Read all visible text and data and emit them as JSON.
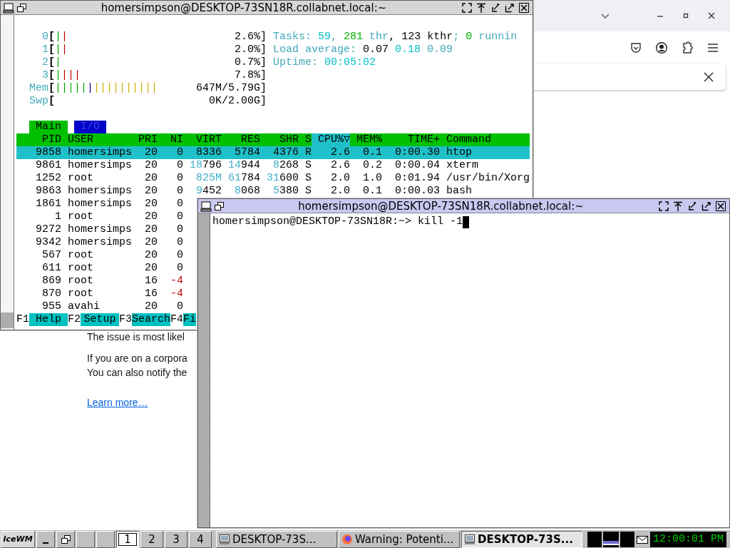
{
  "browser": {
    "paragraphs": [
      [
        "The issue is most likel"
      ],
      [
        "If you are on a corpora",
        "You can also notify the"
      ]
    ],
    "link": "Learn more…"
  },
  "htop": {
    "title": "homersimpson@DESKTOP-73SN18R.collabnet.local:~",
    "active": false,
    "meters": [
      {
        "label": "0",
        "bracket": "[",
        "bars": [
          {
            "text": "|",
            "color": "#00a800"
          },
          {
            "text": "|",
            "color": "#c00000"
          }
        ],
        "value": "2.6%]"
      },
      {
        "label": "1",
        "bracket": "[",
        "bars": [
          {
            "text": "|",
            "color": "#00a800"
          },
          {
            "text": "|",
            "color": "#c00000"
          }
        ],
        "value": "2.0%]"
      },
      {
        "label": "2",
        "bracket": "[",
        "bars": [
          {
            "text": "|",
            "color": "#00a800"
          }
        ],
        "value": "0.7%]"
      },
      {
        "label": "3",
        "bracket": "[",
        "bars": [
          {
            "text": "|",
            "color": "#00a800"
          },
          {
            "text": "|||",
            "color": "#c00000"
          }
        ],
        "value": "7.8%]"
      },
      {
        "label": "Mem",
        "bracket": "[",
        "bars": [
          {
            "text": "|||||",
            "color": "#00a800"
          },
          {
            "text": "|",
            "color": "#0000a8"
          },
          {
            "text": "||||||||||",
            "color": "#c8b000"
          }
        ],
        "value": "647M/5.79G]"
      },
      {
        "label": "Swp",
        "bracket": "[",
        "value": "0K/2.00G]"
      }
    ],
    "summary": [
      [
        {
          "text": "Tasks: ",
          "color": "#40a8b8"
        },
        {
          "text": "59",
          "color": "#00c0c8"
        },
        {
          "text": ", ",
          "color": "#40a8b8"
        },
        {
          "text": "281",
          "color": "#00b000"
        },
        {
          "text": " thr",
          "color": "#40a8b8"
        },
        {
          "text": ", 123 kthr",
          "color": "#000000"
        },
        {
          "text": "; ",
          "color": "#40a8b8"
        },
        {
          "text": "0",
          "color": "#00b000"
        },
        {
          "text": " runnin",
          "color": "#40a8b8"
        }
      ],
      [
        {
          "text": "Load average: ",
          "color": "#40a8b8"
        },
        {
          "text": "0.07 ",
          "color": "#000000"
        },
        {
          "text": "0.18 ",
          "color": "#00c0c8"
        },
        {
          "text": "0.09",
          "color": "#40a8b8"
        }
      ],
      [
        {
          "text": "Uptime: ",
          "color": "#40a8b8"
        },
        {
          "text": "00:05:02",
          "color": "#00c0c8"
        }
      ]
    ],
    "tabs": [
      {
        "label": "Main",
        "selected": true
      },
      {
        "label": "I/O",
        "selected": false
      }
    ],
    "columns": [
      {
        "label": "PID",
        "sorted": false
      },
      {
        "label": "USER",
        "sorted": false
      },
      {
        "label": "PRI",
        "sorted": false
      },
      {
        "label": "NI",
        "sorted": false
      },
      {
        "label": "VIRT",
        "sorted": false
      },
      {
        "label": "RES",
        "sorted": false
      },
      {
        "label": "SHR",
        "sorted": false
      },
      {
        "label": "S",
        "sorted": false
      },
      {
        "label": "CPU%▽",
        "sorted": true
      },
      {
        "label": "MEM%",
        "sorted": false
      },
      {
        "label": "TIME+",
        "sorted": false
      },
      {
        "label": "Command",
        "sorted": false
      }
    ],
    "rows": [
      {
        "selected": true,
        "cells": [
          "9858",
          "homersimps",
          "20",
          "0",
          "8336",
          "5784",
          "4376",
          "R",
          "2.6",
          "0.1",
          "0:00.30",
          "htop"
        ]
      },
      {
        "selected": false,
        "cells": [
          "9861",
          "homersimps",
          "20",
          "0",
          {
            "parts": [
              {
                "text": "18",
                "kind": "thousands"
              },
              {
                "text": "796",
                "kind": "normal"
              }
            ]
          },
          {
            "parts": [
              {
                "text": "14",
                "kind": "thousands"
              },
              {
                "text": "944",
                "kind": "normal"
              }
            ]
          },
          {
            "parts": [
              {
                "text": "8",
                "kind": "thousands"
              },
              {
                "text": "268",
                "kind": "normal"
              }
            ]
          },
          "S",
          "2.6",
          "0.2",
          "0:00.04",
          "xterm"
        ]
      },
      {
        "selected": false,
        "cells": [
          "1252",
          "root",
          "20",
          "0",
          {
            "parts": [
              {
                "text": "825M",
                "kind": "thousands"
              }
            ]
          },
          {
            "parts": [
              {
                "text": "61",
                "kind": "thousands"
              },
              {
                "text": "784",
                "kind": "normal"
              }
            ]
          },
          {
            "parts": [
              {
                "text": "31",
                "kind": "thousands"
              },
              {
                "text": "600",
                "kind": "normal"
              }
            ]
          },
          "S",
          "2.0",
          "1.0",
          "0:01.94",
          "/usr/bin/Xorg"
        ]
      },
      {
        "selected": false,
        "cells": [
          "9863",
          "homersimps",
          "20",
          "0",
          {
            "parts": [
              {
                "text": "9",
                "kind": "thousands"
              },
              {
                "text": "452",
                "kind": "normal"
              }
            ]
          },
          {
            "parts": [
              {
                "text": "8",
                "kind": "thousands"
              },
              {
                "text": "068",
                "kind": "normal"
              }
            ]
          },
          {
            "parts": [
              {
                "text": "5",
                "kind": "thousands"
              },
              {
                "text": "380",
                "kind": "normal"
              }
            ]
          },
          "S",
          "2.0",
          "0.1",
          "0:00.03",
          "bash"
        ]
      },
      {
        "selected": false,
        "cells": [
          "1861",
          "homersimps",
          "20",
          "0"
        ]
      },
      {
        "selected": false,
        "cells": [
          "1",
          "root",
          "20",
          "0"
        ]
      },
      {
        "selected": false,
        "cells": [
          "9272",
          "homersimps",
          "20",
          "0"
        ]
      },
      {
        "selected": false,
        "cells": [
          "9342",
          "homersimps",
          "20",
          "0"
        ]
      },
      {
        "selected": false,
        "cells": [
          "567",
          "root",
          "20",
          "0"
        ]
      },
      {
        "selected": false,
        "cells": [
          "611",
          "root",
          "20",
          "0"
        ]
      },
      {
        "selected": false,
        "cells": [
          "869",
          "root",
          "16",
          {
            "parts": [
              {
                "text": "-4",
                "kind": "negative"
              }
            ]
          }
        ]
      },
      {
        "selected": false,
        "cells": [
          "870",
          "root",
          "16",
          {
            "parts": [
              {
                "text": "-4",
                "kind": "negative"
              }
            ]
          }
        ]
      },
      {
        "selected": false,
        "cells": [
          "955",
          "avahi",
          "20",
          "0"
        ]
      }
    ],
    "function_keys": [
      {
        "key": "F1",
        "label": "Help"
      },
      {
        "key": "F2",
        "label": "Setup"
      },
      {
        "key": "F3",
        "label": "Search"
      },
      {
        "key": "F4",
        "label": "Fi"
      }
    ]
  },
  "terminal": {
    "title": "homersimpson@DESKTOP-73SN18R.collabnet.local:~",
    "active": true,
    "lines": [
      "homersimpson@DESKTOP-73SN18R:~> kill -1"
    ]
  },
  "taskbar": {
    "logo": "IceWM",
    "workspaces": [
      {
        "label": "1",
        "selected": true
      },
      {
        "label": "2",
        "selected": false
      },
      {
        "label": "3",
        "selected": false
      },
      {
        "label": "4",
        "selected": false
      }
    ],
    "tasks": [
      {
        "label": "DESKTOP-73S...",
        "kind": "terminal",
        "selected": false
      },
      {
        "label": "Warning: Potenti...",
        "kind": "browser",
        "selected": false
      },
      {
        "label": "DESKTOP-73S...",
        "kind": "terminal",
        "selected": true
      }
    ],
    "clock": "12:00:01 PM"
  }
}
